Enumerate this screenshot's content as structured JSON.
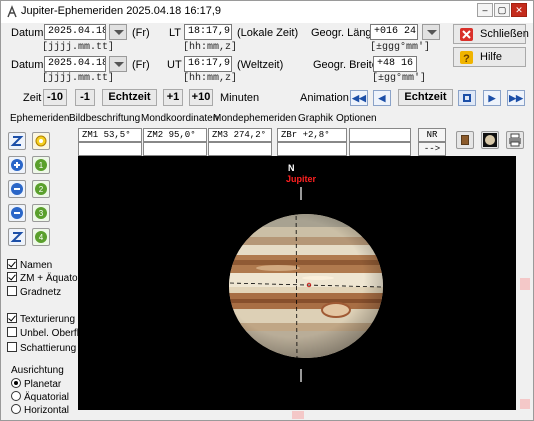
{
  "window": {
    "app_title": "Jupiter-Ephemeriden",
    "date_stamp": "2025.04.18",
    "time_stamp": "16:17,9",
    "min_symbol": "–",
    "max_symbol": "▢",
    "close_symbol": "✕"
  },
  "row1": {
    "date_label": "Datum",
    "date_value": "2025.04.18",
    "weekday": "(Fr)",
    "date_format": "[jjjj.mm.tt]",
    "time_label": "LT",
    "time_value": "18:17,9",
    "time_note": "(Lokale Zeit)",
    "time_format": "[hh:mm,z]",
    "geo_label": "Geogr. Länge",
    "geo_value": "+016 24",
    "geo_format": "[±ggg°mm']"
  },
  "row2": {
    "date_label": "Datum",
    "date_value": "2025.04.18",
    "weekday": "(Fr)",
    "date_format": "[jjjj.mm.tt]",
    "time_label": "UT",
    "time_value": "16:17,9",
    "time_note": "(Weltzeit)",
    "time_format": "[hh:mm,z]",
    "geo_label": "Geogr. Breite",
    "geo_value": "+48 16",
    "geo_format": "[±gg°mm']"
  },
  "buttons": {
    "close_label": "Schließen",
    "help_label": "Hilfe"
  },
  "timebar": {
    "zeit_label": "Zeit",
    "minus10": "-10",
    "minus1": "-1",
    "echtzeit": "Echtzeit",
    "plus1": "+1",
    "plus10": "+10",
    "minuten_label": "Minuten",
    "animation_label": "Animation",
    "anim_echtzeit": "Echtzeit",
    "nav_first": "◀◀",
    "nav_prev": "◀",
    "nav_next": "▶",
    "nav_last": "▶▶"
  },
  "menu": [
    "Ephemeriden",
    "Bildbeschriftung",
    "Mondkoordinaten",
    "Mondephemeriden",
    "Graphik",
    "Optionen"
  ],
  "cells": {
    "zm1": "ZM1  53,5°",
    "zm2": "ZM2  95,0°",
    "zm3": "ZM3 274,2°",
    "zbr": "ZBr  +2,8°",
    "nr": "NR",
    "arrow": "-->"
  },
  "left_tools": {
    "n1": "1",
    "n2": "2",
    "n3": "3",
    "n4": "4"
  },
  "options": {
    "namen": "Namen",
    "zm_aquator": "ZM + Äquator",
    "gradnetz": "Gradnetz",
    "texturierung": "Texturierung",
    "unbel": "Unbel. Oberfl.",
    "schattierung": "Schattierung"
  },
  "orientation": {
    "title": "Ausrichtung",
    "planetar": "Planetar",
    "aquatorial": "Äquatorial",
    "horizontal": "Horizontal"
  },
  "graphic": {
    "north_label": "N",
    "planet_name": "Jupiter"
  },
  "colors": {
    "planet_label": "#ff2020",
    "accent": "#1c4fa8",
    "canvas_bg": "#000000"
  }
}
